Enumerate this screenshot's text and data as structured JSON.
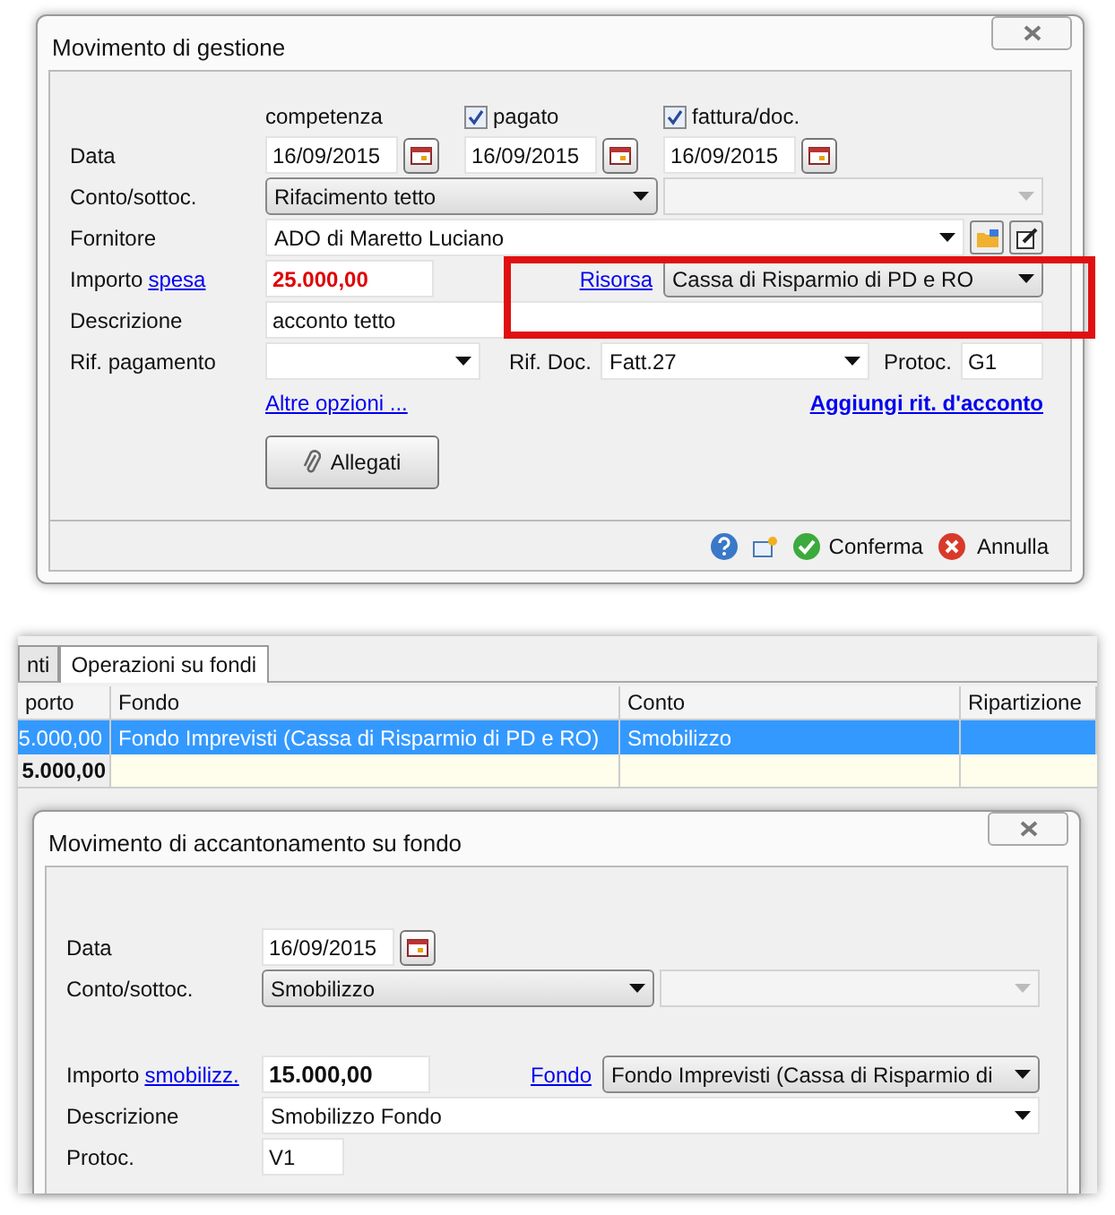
{
  "dialog1": {
    "title": "Movimento di gestione",
    "date_headers": [
      {
        "kind": "plain",
        "label": "competenza"
      },
      {
        "kind": "checkbox",
        "label": "pagato",
        "checked": true
      },
      {
        "kind": "checkbox",
        "label": "fattura/doc.",
        "checked": true
      }
    ],
    "data_label": "Data",
    "dates": [
      "16/09/2015",
      "16/09/2015",
      "16/09/2015"
    ],
    "conto_label": "Conto/sottoc.",
    "conto_value": "Rifacimento tetto",
    "fornitore_label": "Fornitore",
    "fornitore_value": "ADO di Maretto Luciano",
    "importo_label": "Importo",
    "importo_link": "spesa",
    "importo_value": "25.000,00",
    "risorsa_link": "Risorsa",
    "risorsa_value": "Cassa di Risparmio di PD e RO",
    "descrizione_label": "Descrizione",
    "descrizione_value": "acconto tetto",
    "rif_pag_label": "Rif. pagamento",
    "rif_doc_label": "Rif. Doc.",
    "rif_doc_value": "Fatt.27",
    "protoc_label": "Protoc.",
    "protoc_value": "G1",
    "altre_link": "Altre opzioni ...",
    "ritenuta_link": "Aggiungi rit. d'acconto",
    "allegati_button": "Allegati",
    "confirm_button": "Conferma",
    "cancel_button": "Annulla"
  },
  "window2": {
    "tabs": [
      {
        "label": "nti",
        "selected": false
      },
      {
        "label": "Operazioni su fondi",
        "selected": true
      }
    ],
    "table": {
      "columns": [
        "porto",
        "Fondo",
        "Conto",
        "Ripartizione"
      ],
      "rows": [
        {
          "selected": true,
          "cells": [
            "5.000,00",
            "Fondo Imprevisti (Cassa di Risparmio di PD e RO)",
            "Smobilizzo",
            ""
          ]
        }
      ],
      "total": "5.000,00"
    }
  },
  "dialog2": {
    "title": "Movimento di accantonamento su fondo",
    "data_label": "Data",
    "date": "16/09/2015",
    "conto_label": "Conto/sottoc.",
    "conto_value": "Smobilizzo",
    "importo_label": "Importo",
    "importo_link": "smobilizz.",
    "importo_value": "15.000,00",
    "fondo_link": "Fondo",
    "fondo_value": "Fondo Imprevisti (Cassa di Risparmio di",
    "descrizione_label": "Descrizione",
    "descrizione_value": "Smobilizzo Fondo",
    "protoc_label": "Protoc.",
    "protoc_value": "V1"
  }
}
